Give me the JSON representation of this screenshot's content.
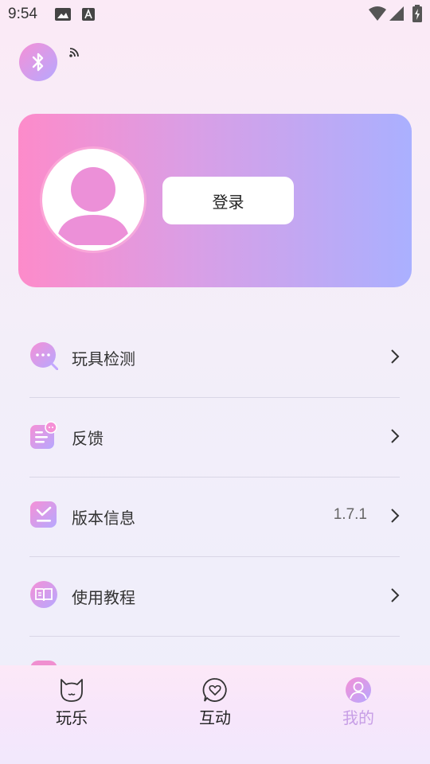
{
  "status_bar": {
    "time": "9:54"
  },
  "profile": {
    "login_label": "登录"
  },
  "menu": [
    {
      "label": "玩具检测",
      "value": ""
    },
    {
      "label": "反馈",
      "value": ""
    },
    {
      "label": "版本信息",
      "value": "1.7.1"
    },
    {
      "label": "使用教程",
      "value": ""
    }
  ],
  "tabs": [
    {
      "label": "玩乐",
      "icon": "cat-icon",
      "active": false
    },
    {
      "label": "互动",
      "icon": "heart-chat-icon",
      "active": false
    },
    {
      "label": "我的",
      "icon": "person-icon",
      "active": true
    }
  ],
  "colors": {
    "accent_pink": "#fd8bca",
    "accent_purple": "#aab0ff",
    "active_tab": "#c79ee6"
  }
}
